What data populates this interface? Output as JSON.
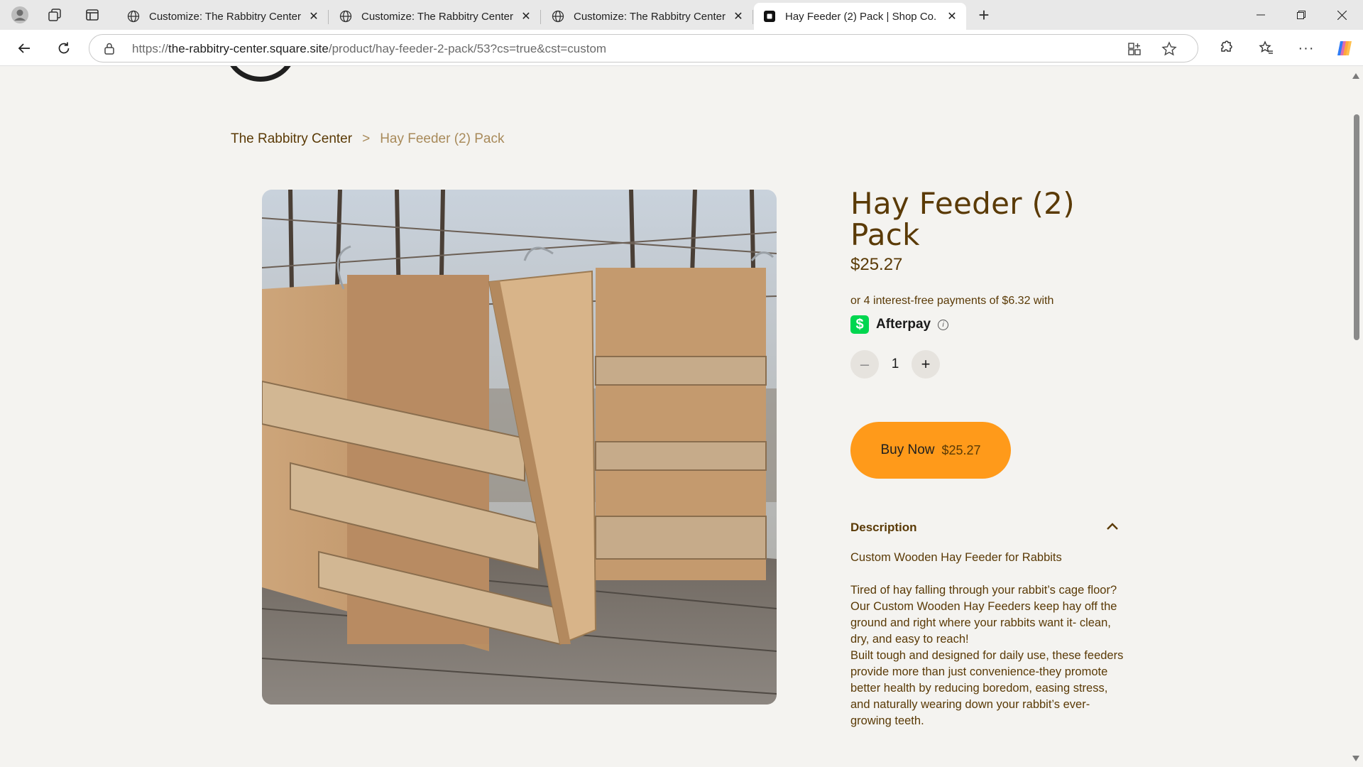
{
  "browser": {
    "tabs": [
      {
        "title": "Customize: The Rabbitry Center -",
        "active": false
      },
      {
        "title": "Customize: The Rabbitry Center -",
        "active": false
      },
      {
        "title": "Customize: The Rabbitry Center -",
        "active": false
      },
      {
        "title": "Hay Feeder (2) Pack | Shop Co.",
        "active": true
      }
    ],
    "url_scheme": "https://",
    "url_host": "the-rabbitry-center.square.site",
    "url_path": "/product/hay-feeder-2-pack/53?cs=true&cst=custom"
  },
  "breadcrumb": {
    "home": "The Rabbitry Center",
    "separator": ">",
    "current": "Hay Feeder (2) Pack"
  },
  "product": {
    "title": "Hay Feeder (2) Pack",
    "price": "$25.27",
    "afterpay_text": "or 4 interest-free payments of $6.32 with",
    "afterpay_label": "Afterpay",
    "afterpay_logo_glyph": "$",
    "quantity": "1",
    "buy_label": "Buy Now",
    "buy_price": "$25.27",
    "image_alt": "Two wooden hay feeders on a deck"
  },
  "description": {
    "heading": "Description",
    "expanded": true,
    "lines": [
      "Custom Wooden Hay Feeder for Rabbits",
      "Tired of hay falling through your rabbit’s cage floor?",
      "Our Custom Wooden Hay Feeders keep hay off the ground and right where your rabbits want it- clean, dry, and easy to reach!",
      "Built tough and designed for daily use, these feeders provide more than just convenience-they promote better health by reducing boredom, easing stress, and naturally wearing down your rabbit’s ever-growing teeth."
    ]
  },
  "colors": {
    "accent_brown": "#5a3a06",
    "muted_brown": "#a88a5a",
    "buy_button": "#ff9a1a",
    "afterpay_green": "#00d64f",
    "page_bg": "#f4f3f0"
  }
}
